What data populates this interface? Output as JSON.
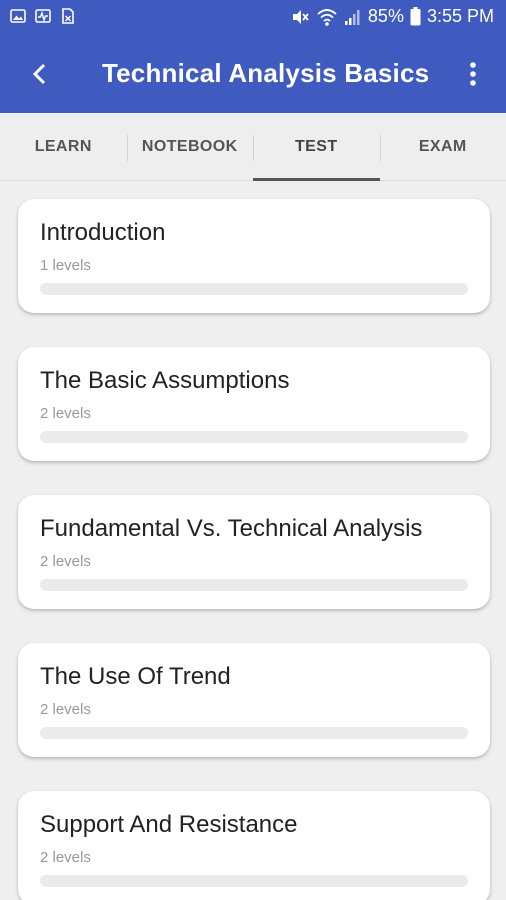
{
  "status_bar": {
    "left_icons": [
      "image-icon",
      "activity-icon",
      "document-icon"
    ],
    "battery": "85%",
    "time": "3:55 PM"
  },
  "app_bar": {
    "title": "Technical Analysis Basics"
  },
  "tabs": [
    {
      "label": "LEARN",
      "active": false
    },
    {
      "label": "NOTEBOOK",
      "active": false
    },
    {
      "label": "TEST",
      "active": true
    },
    {
      "label": "EXAM",
      "active": false
    }
  ],
  "topics": [
    {
      "title": "Introduction",
      "levels": "1 levels",
      "progress": 0
    },
    {
      "title": "The Basic Assumptions",
      "levels": "2 levels",
      "progress": 0
    },
    {
      "title": "Fundamental Vs. Technical Analysis",
      "levels": "2 levels",
      "progress": 0
    },
    {
      "title": "The Use Of Trend",
      "levels": "2 levels",
      "progress": 0
    },
    {
      "title": "Support And Resistance",
      "levels": "2 levels",
      "progress": 0
    }
  ],
  "colors": {
    "primary": "#3f5bbf",
    "background": "#efefef"
  }
}
